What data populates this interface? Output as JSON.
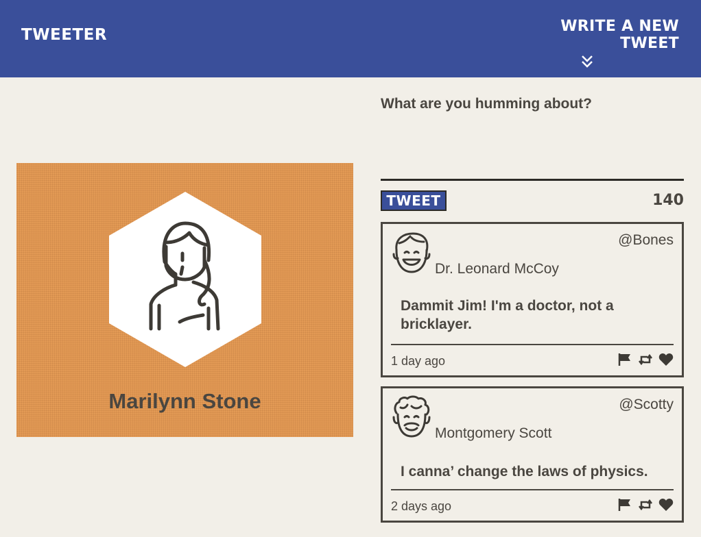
{
  "nav": {
    "brand": "TWEETER",
    "write_label": "WRITE A NEW TWEET",
    "chevron_icon": "double-chevron-down-icon"
  },
  "profile": {
    "name": "Marilynn Stone",
    "avatar_icon": "woman-avatar-icon",
    "background_color": "#e39a55"
  },
  "compose": {
    "prompt": "What are you humming about?",
    "button_label": "TWEET",
    "counter": "140"
  },
  "tweets": [
    {
      "handle": "@Bones",
      "name": "Dr. Leonard McCoy",
      "text": "Dammit Jim! I'm a doctor, not a bricklayer.",
      "time": "1 day ago",
      "avatar_icon": "smiling-man-avatar-icon"
    },
    {
      "handle": "@Scotty",
      "name": "Montgomery Scott",
      "text": "I canna’ change the laws of physics.",
      "time": "2 days ago",
      "avatar_icon": "curly-hair-man-avatar-icon"
    }
  ],
  "actions": [
    "flag-icon",
    "retweet-icon",
    "heart-icon"
  ],
  "colors": {
    "nav": "#3a4f9a",
    "background": "#f2efe8",
    "text": "#4a4640"
  }
}
